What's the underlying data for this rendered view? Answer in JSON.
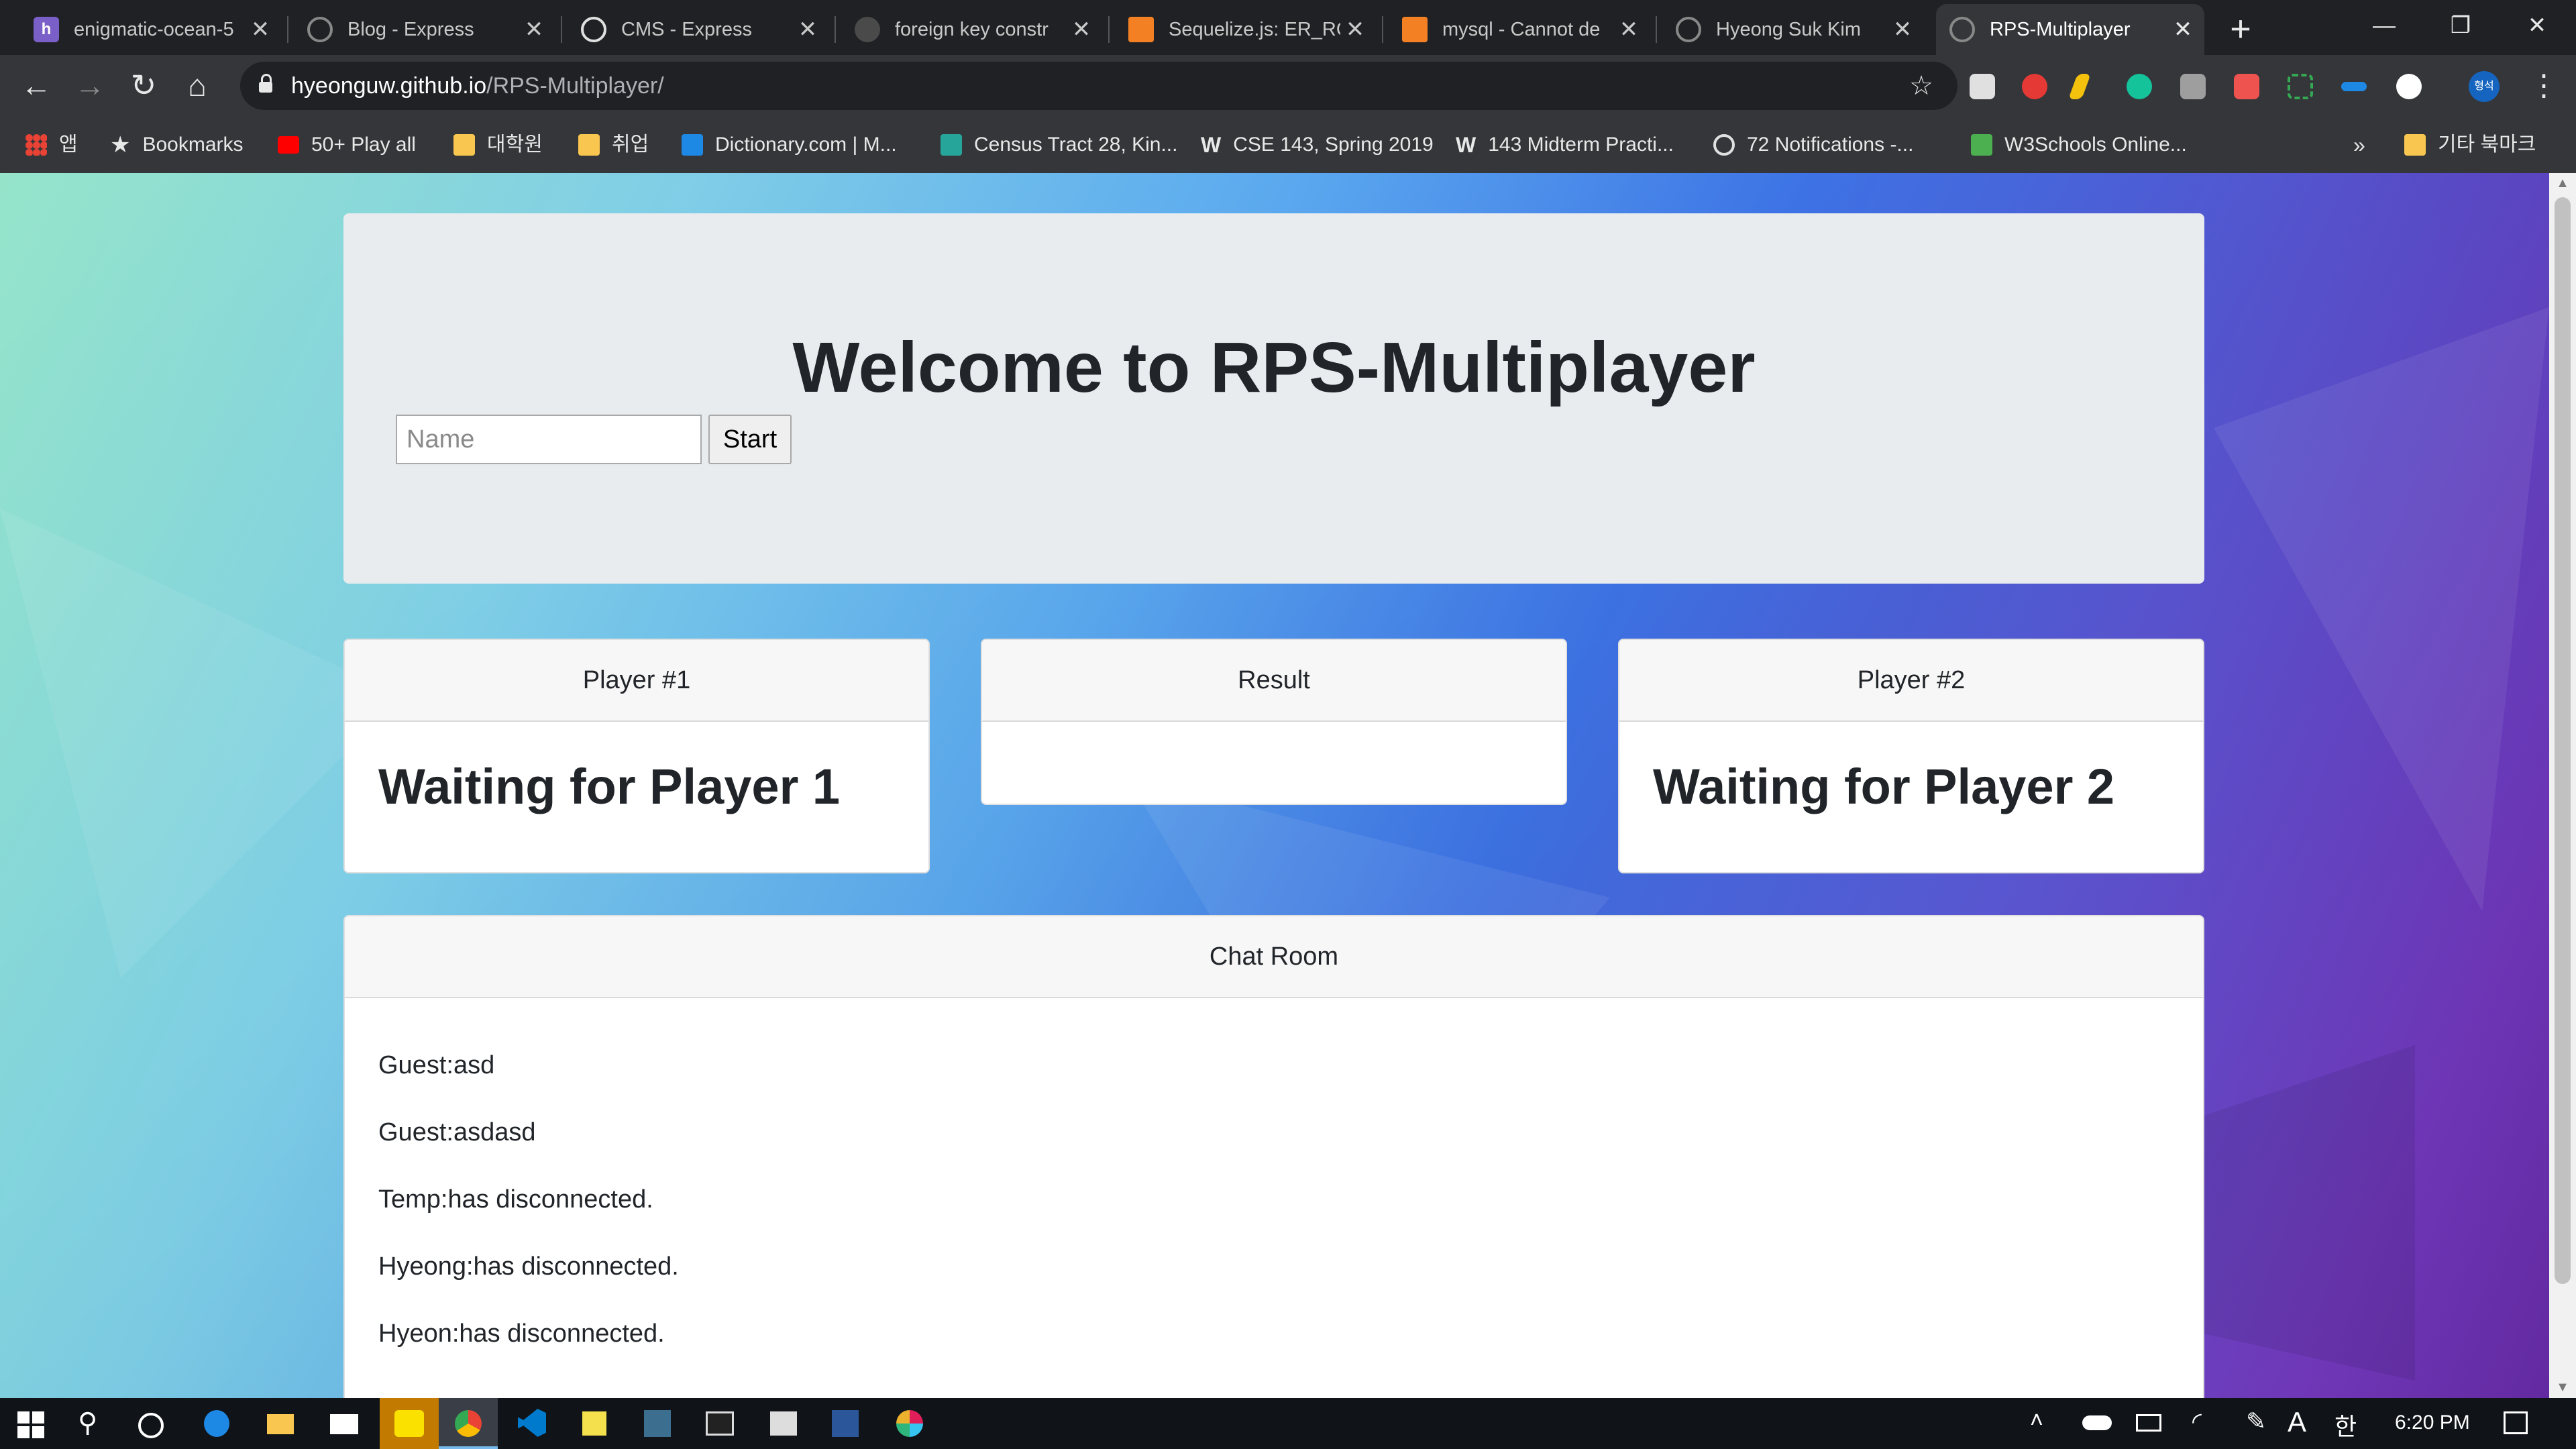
{
  "browser": {
    "tabs": [
      {
        "title": "enigmatic-ocean-5",
        "favicon": "heroku-icon",
        "active": false
      },
      {
        "title": "Blog - Express",
        "favicon": "globe-icon",
        "active": false
      },
      {
        "title": "CMS - Express",
        "favicon": "globe-icon",
        "active": false
      },
      {
        "title": "foreign key constr",
        "favicon": "github-icon",
        "active": false
      },
      {
        "title": "Sequelize.js: ER_RO",
        "favicon": "stackoverflow-icon",
        "active": false
      },
      {
        "title": "mysql - Cannot de",
        "favicon": "stackoverflow-icon",
        "active": false
      },
      {
        "title": "Hyeong Suk Kim",
        "favicon": "globe-icon",
        "active": false
      },
      {
        "title": "RPS-Multiplayer",
        "favicon": "globe-icon",
        "active": true
      }
    ],
    "url_host": "hyeonguw.github.io",
    "url_path": "/RPS-Multiplayer/",
    "bookmarks": [
      {
        "label": "앱",
        "icon": "apps-grid-icon"
      },
      {
        "label": "Bookmarks",
        "icon": "star-icon"
      },
      {
        "label": "50+ Play all",
        "icon": "youtube-icon"
      },
      {
        "label": "대학원",
        "icon": "folder-icon"
      },
      {
        "label": "취업",
        "icon": "folder-icon"
      },
      {
        "label": "Dictionary.com | M...",
        "icon": "dictionary-icon"
      },
      {
        "label": "Census Tract 28, Kin...",
        "icon": "census-icon"
      },
      {
        "label": "CSE 143, Spring 2019",
        "icon": "uw-icon"
      },
      {
        "label": "143 Midterm Practi...",
        "icon": "uw-icon"
      },
      {
        "label": "72 Notifications -...",
        "icon": "globe-icon"
      },
      {
        "label": "W3Schools Online...",
        "icon": "w3schools-icon"
      }
    ],
    "bookmarks_overflow": "»",
    "other_bookmarks": "기타 북마크",
    "profile_initials": "형석"
  },
  "page": {
    "title": "Welcome to RPS-Multiplayer",
    "name_placeholder": "Name",
    "name_value": "",
    "start_label": "Start",
    "player1": {
      "header": "Player #1",
      "status": "Waiting for Player 1"
    },
    "result": {
      "header": "Result",
      "text": ""
    },
    "player2": {
      "header": "Player #2",
      "status": "Waiting for Player 2"
    },
    "chat": {
      "header": "Chat Room",
      "messages": [
        "Guest:asd",
        "Guest:asdasd",
        "Temp:has disconnected.",
        "Hyeong:has disconnected.",
        "Hyeon:has disconnected."
      ]
    }
  },
  "taskbar": {
    "time": "6:20 PM",
    "ime": "A",
    "ime2": "한"
  },
  "colors": {
    "tab_bg": "#202124",
    "toolbar_bg": "#35363a",
    "jumbotron_bg": "#e9ecef",
    "card_header_bg": "#f7f7f7",
    "text": "#212529",
    "taskbar_bg": "#101418"
  }
}
